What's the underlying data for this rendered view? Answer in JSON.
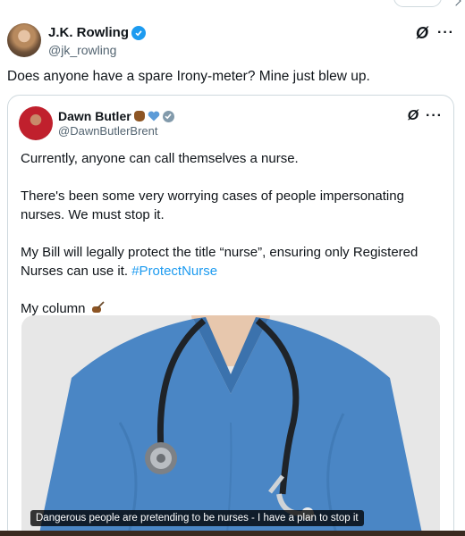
{
  "author": {
    "name": "J.K. Rowling",
    "handle": "@jk_rowling"
  },
  "tweet": {
    "text": "Does anyone have a spare Irony-meter? Mine just blew up."
  },
  "quoted": {
    "name": "Dawn Butler",
    "handle": "@DawnButlerBrent",
    "paragraphs": [
      "Currently, anyone can call themselves a nurse.",
      "There's been some very worrying cases of people impersonating nurses. We must stop it."
    ],
    "bill_text": "My Bill will legally protect the title “nurse”, ensuring only Registered Nurses can use it. ",
    "hashtag": "#ProtectNurse",
    "closing": "My column",
    "media_caption": "Dangerous people are pretending to be nurses - I have a plan to stop it"
  },
  "icons": {
    "verified": "verified-badge-icon",
    "grok": "grok-icon",
    "more": "more-icon"
  },
  "colors": {
    "accent": "#1d9bf0",
    "scrubs": "#4a86c5",
    "secondary_text": "#536471"
  }
}
